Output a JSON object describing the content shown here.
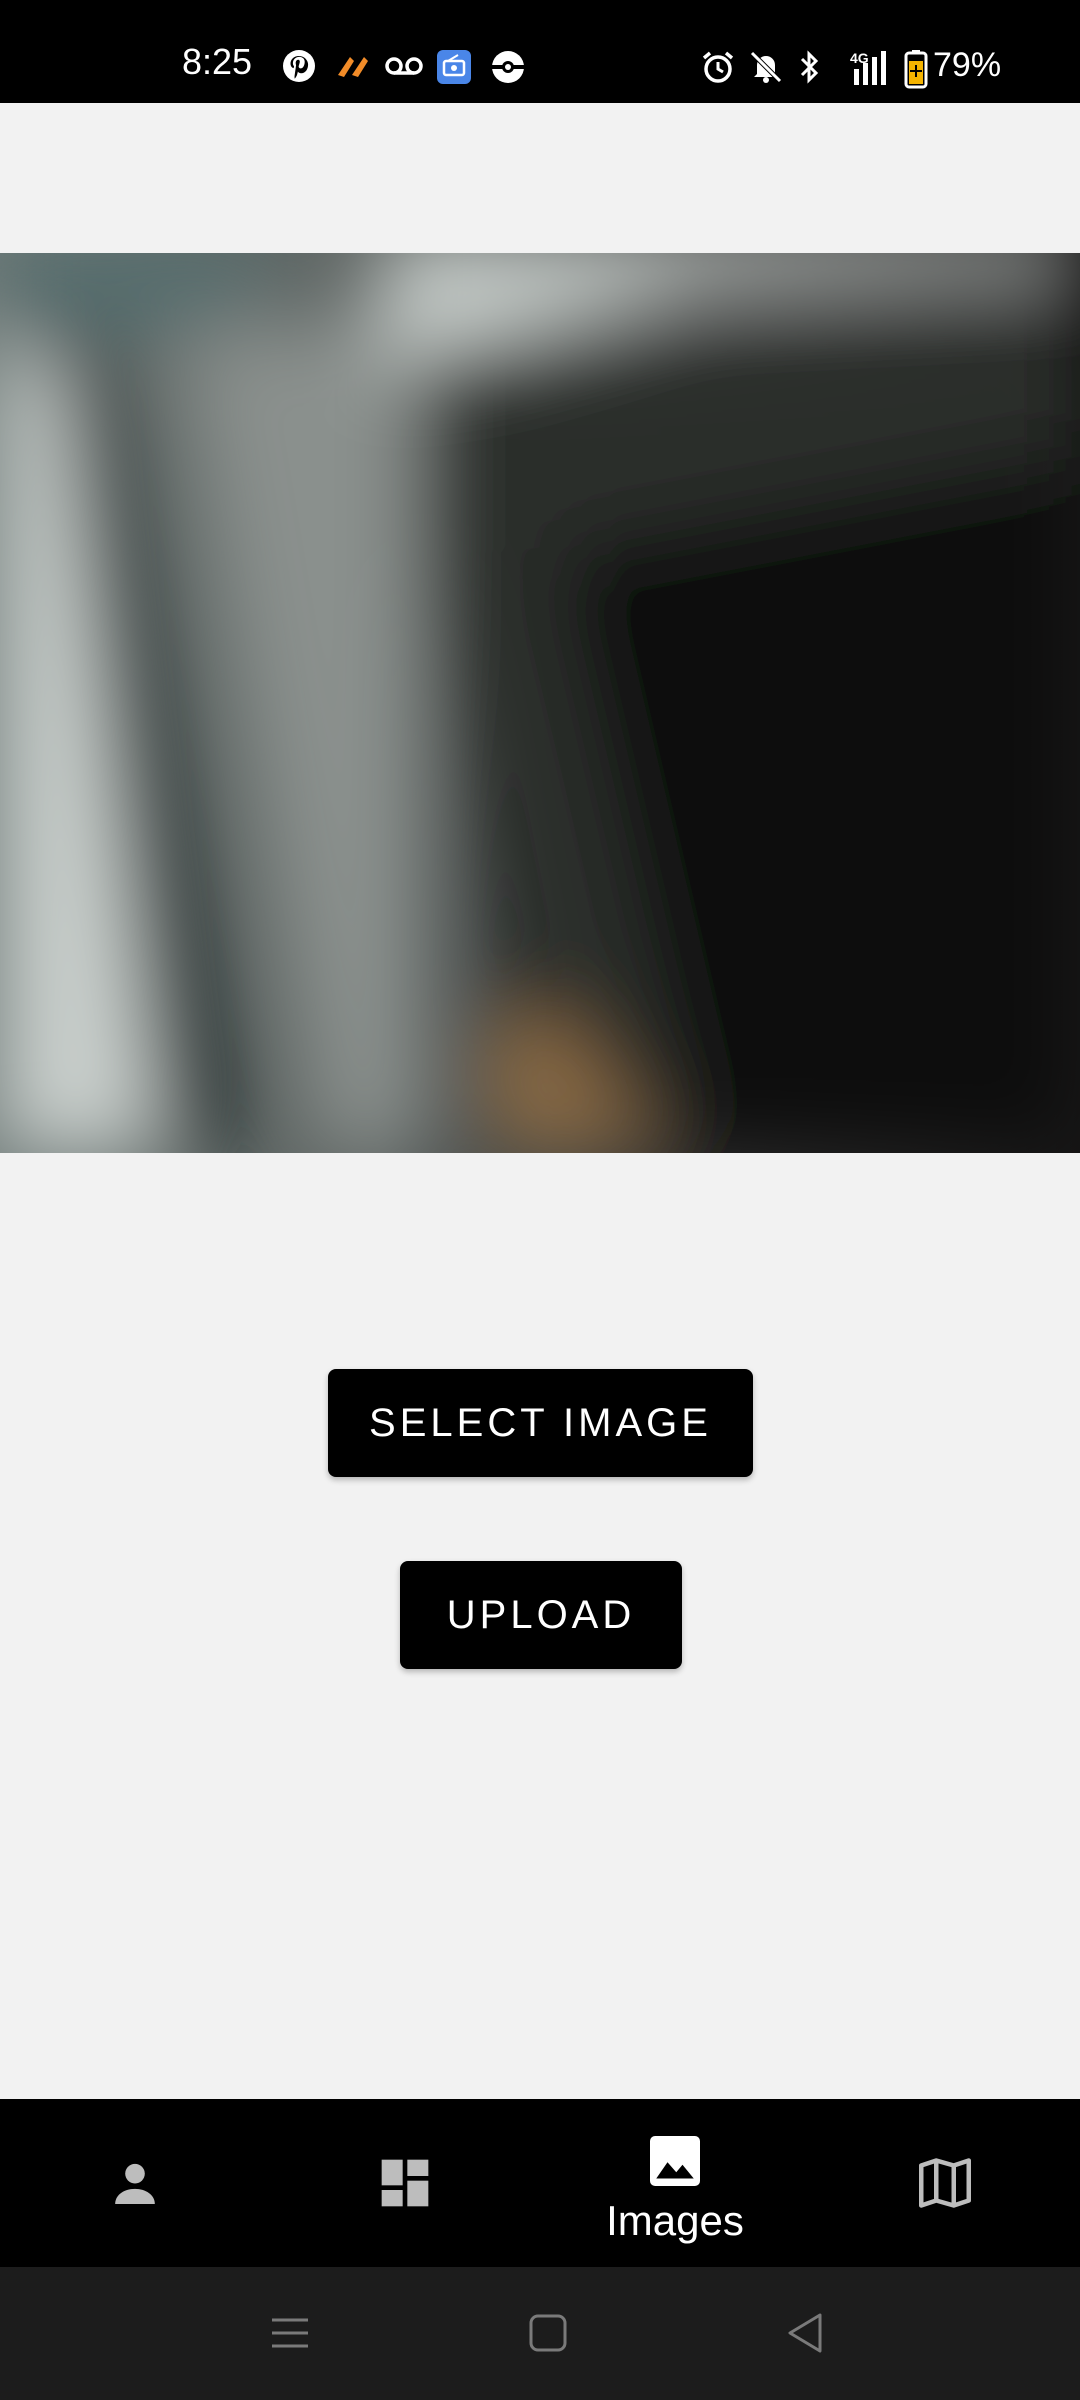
{
  "status_bar": {
    "time": "8:25",
    "battery": "79%",
    "icons": [
      "pinterest-icon",
      "app-icon",
      "voicemail-icon",
      "radio-app-icon",
      "pokeball-icon",
      "alarm-icon",
      "mute-icon",
      "bluetooth-icon",
      "signal-4g-icon",
      "battery-icon"
    ],
    "network": "4G"
  },
  "main": {
    "select_label": "SELECT IMAGE",
    "upload_label": "UPLOAD"
  },
  "bottom_nav": {
    "items": [
      {
        "icon": "person-icon",
        "label": ""
      },
      {
        "icon": "dashboard-icon",
        "label": ""
      },
      {
        "icon": "image-icon",
        "label": "Images",
        "active": true
      },
      {
        "icon": "map-icon",
        "label": ""
      }
    ]
  },
  "colors": {
    "background": "#f2f2f2",
    "bar": "#000000",
    "nav_inactive": "#bdbdbd",
    "nav_active": "#ffffff",
    "system_nav": "#1c1c1c"
  }
}
